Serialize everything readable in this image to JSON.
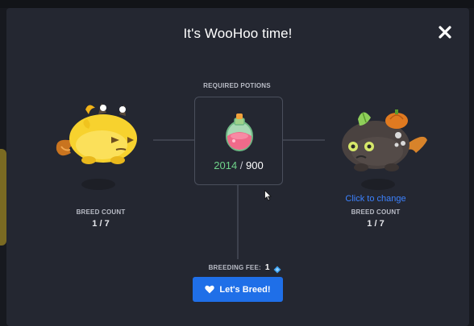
{
  "modal": {
    "title": "It's WooHoo time!",
    "close_icon": "close-icon"
  },
  "potions": {
    "label": "REQUIRED POTIONS",
    "have": "2014",
    "separator": " / ",
    "required": "900",
    "icon": "potion-flask-icon",
    "have_color": "#6fd38a"
  },
  "parent_left": {
    "breed_count_label": "BREED COUNT",
    "breed_count": "1 / 7",
    "image": "yellow-axie-image"
  },
  "parent_right": {
    "change_link": "Click to change",
    "breed_count_label": "BREED COUNT",
    "breed_count": "1 / 7",
    "image": "dark-axie-image"
  },
  "fee": {
    "label": "BREEDING FEE:",
    "value": "1",
    "icon": "axs-token-icon"
  },
  "breed_button": {
    "label": "Let's Breed!",
    "icon": "heart-icon",
    "color": "#1f6fe8"
  }
}
